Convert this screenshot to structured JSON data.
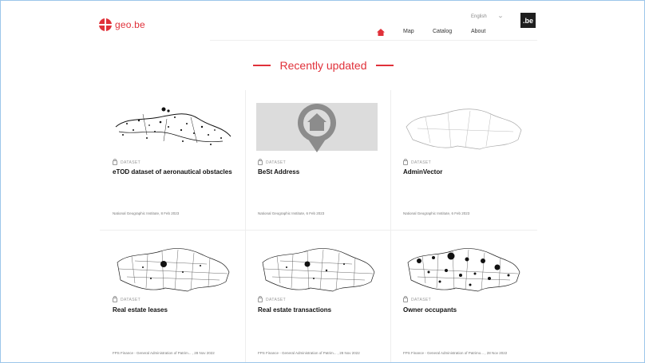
{
  "header": {
    "logo_text": "geo.be",
    "language": "English",
    "badge": ".be",
    "nav": {
      "map": "Map",
      "catalog": "Catalog",
      "about": "About"
    }
  },
  "section": {
    "title": "Recently updated"
  },
  "cards": [
    {
      "type": "DATASET",
      "title": "eTOD dataset of aeronautical obstacles",
      "meta": "National Geographic Institute, 8 Feb 2023",
      "thumbnail": "scatter-map"
    },
    {
      "type": "DATASET",
      "title": "BeSt Address",
      "meta": "National Geographic Institute, 6 Feb 2023",
      "thumbnail": "home-pin-icon"
    },
    {
      "type": "DATASET",
      "title": "AdminVector",
      "meta": "National Geographic Institute, 6 Feb 2023",
      "thumbnail": "outline-map"
    },
    {
      "type": "DATASET",
      "title": "Real estate leases",
      "meta": "FPS Finance - General Administration of Patrim... , 28 Nov 2022",
      "thumbnail": "region-map"
    },
    {
      "type": "DATASET",
      "title": "Real estate transactions",
      "meta": "FPS Finance - General Administration of Patrim... , 28 Nov 2022",
      "thumbnail": "region-map"
    },
    {
      "type": "DATASET",
      "title": "Owner occupants",
      "meta": "FPS Finance - General Administration of Patrimo... , 28 Nov 2022",
      "thumbnail": "region-map-dots"
    }
  ],
  "colors": {
    "accent": "#e0313a",
    "frame_border": "#9cc6ea"
  }
}
